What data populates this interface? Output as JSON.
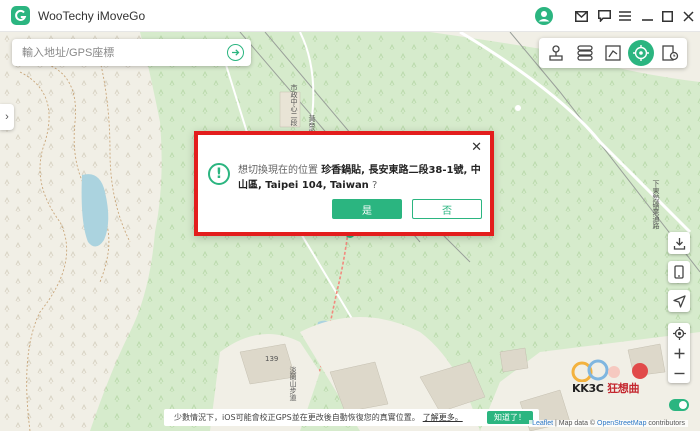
{
  "app": {
    "title": "WooTechy iMoveGo"
  },
  "search": {
    "placeholder": "輸入地址/GPS座標"
  },
  "dialog": {
    "message_prefix": "想切換現在的位置 ",
    "place": "珍香鍋貼, 長安東路二段38-1號, 中山區, Taipei 104, Taiwan",
    "message_suffix": " ?",
    "yes_label": "是",
    "no_label": "否"
  },
  "notice": {
    "text": "少數情況下，iOS可能會校正GPS並在更改後自動恢復您的真實位置。",
    "link": "了解更多。",
    "button": "知道了！"
  },
  "attribution": {
    "leaflet": "Leaflet",
    "map_data": " | Map data © ",
    "osm": "OpenStreetMap",
    "contributors": " contributors"
  },
  "map_labels": {
    "road_vertical_1": "市政中心二段",
    "road_vertical_2": "黃帝殿",
    "road_vertical_3": "下東勢礦業通路",
    "road_vertical_4": "淡蘭山步道",
    "building_number": "139"
  },
  "watermark": {
    "kk": "KK3C",
    "red": "狂想曲"
  },
  "icons": {
    "logo": "app-logo-icon",
    "user": "user-avatar-icon",
    "mail": "mail-icon",
    "feedback": "feedback-icon",
    "menu": "menu-icon",
    "minimize": "minimize-icon",
    "maximize": "maximize-icon",
    "close": "close-icon"
  },
  "colors": {
    "accent": "#2bb580",
    "highlight": "#e31d1d"
  }
}
